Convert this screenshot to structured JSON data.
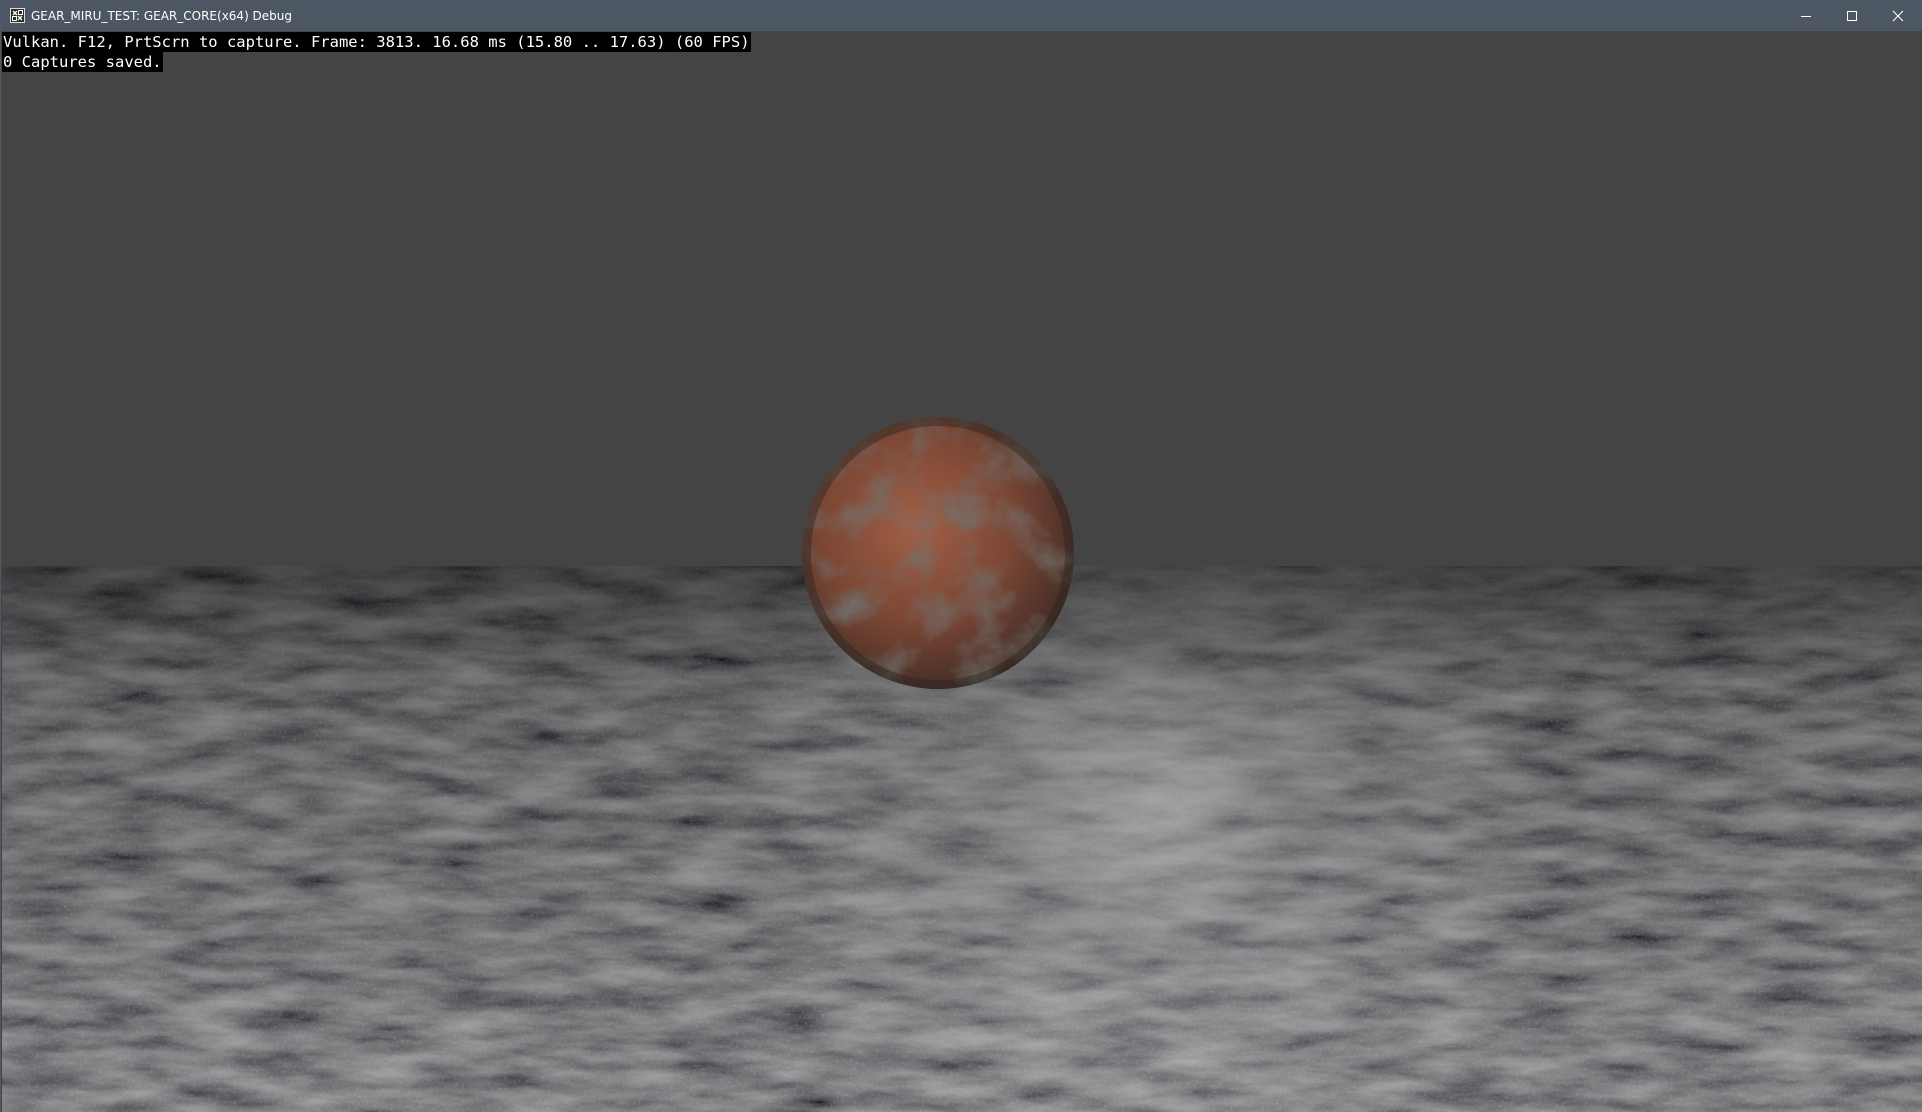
{
  "window": {
    "title": "GEAR_MIRU_TEST: GEAR_CORE(x64) Debug",
    "controls": {
      "minimize_icon": "minimize-icon",
      "maximize_icon": "maximize-icon",
      "close_icon": "close-icon"
    },
    "colors": {
      "titlebar": "#4d5763",
      "title_text": "#ffffff"
    }
  },
  "overlay": {
    "line1": "Vulkan. F12, PrtScrn to capture. Frame: 3813. 16.68 ms (15.80 .. 17.63) (60 FPS)",
    "line2": "0 Captures saved."
  },
  "scene": {
    "sky_color": "#444444",
    "ground_color": "#1e1e1f",
    "sphere_color": "#7a4634"
  }
}
